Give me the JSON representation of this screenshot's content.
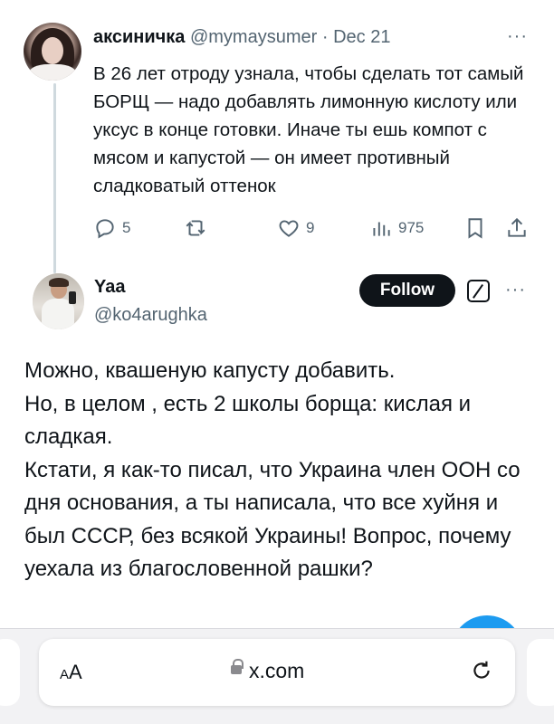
{
  "tweet1": {
    "name": "аксиничка",
    "handle": "@mymaysumer",
    "separator": "·",
    "date": "Dec 21",
    "more": "···",
    "text": "В 26 лет отроду узнала, чтобы сделать тот самый БОРЩ — надо добавлять лимонную кислоту или уксус в конце готовки. Иначе ты ешь компот с мясом и капустой — он имеет противный сладковатый оттенок",
    "actions": {
      "replies": "5",
      "retweets": "",
      "likes": "9",
      "views": "975"
    }
  },
  "tweet2": {
    "name": "Yaa",
    "handle": "@ko4arughka",
    "follow_label": "Follow",
    "more": "···",
    "paragraphs": [
      "Можно, квашеную капусту добавить.",
      "Но, в целом , есть 2 школы борща: кислая и сладкая.",
      "Кстати, я как-то писал, что Украина член ООН со дня основания, а ты написала, что все хуйня и был СССР, без всякой Украины! Вопрос, почему уехала из благословенной рашки?"
    ]
  },
  "browser": {
    "aa_label_small": "A",
    "aa_label_big": "A",
    "url": "x.com"
  },
  "colors": {
    "accent": "#1d9bf0",
    "text": "#0f1419",
    "secondary": "#536471"
  }
}
